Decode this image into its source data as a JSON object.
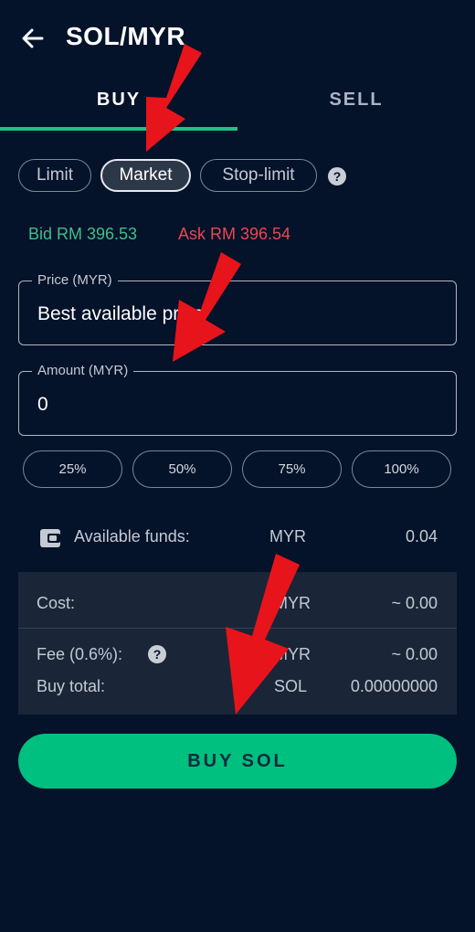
{
  "header": {
    "title": "SOL/MYR"
  },
  "tabs": [
    {
      "label": "BUY"
    },
    {
      "label": "SELL"
    }
  ],
  "order_types": [
    {
      "label": "Limit"
    },
    {
      "label": "Market"
    },
    {
      "label": "Stop-limit"
    }
  ],
  "help_glyph": "?",
  "quotes": {
    "bid": "Bid RM 396.53",
    "ask": "Ask RM 396.54"
  },
  "price_field": {
    "label": "Price (MYR)",
    "value": "Best available price"
  },
  "amount_field": {
    "label": "Amount (MYR)",
    "value": "0"
  },
  "percent_buttons": [
    {
      "label": "25%"
    },
    {
      "label": "50%"
    },
    {
      "label": "75%"
    },
    {
      "label": "100%"
    }
  ],
  "funds": {
    "label": "Available funds:",
    "currency": "MYR",
    "value": "0.04"
  },
  "summary": {
    "cost": {
      "label": "Cost:",
      "currency": "MYR",
      "value": "~ 0.00"
    },
    "fee": {
      "label": "Fee (0.6%):",
      "currency": "MYR",
      "value": "~ 0.00"
    },
    "total": {
      "label": "Buy total:",
      "currency": "SOL",
      "value": "0.00000000"
    }
  },
  "buy_button": {
    "label": "BUY SOL"
  },
  "colors": {
    "accent": "#00c07f",
    "bid": "#3fbf8a",
    "ask": "#e9484f",
    "background": "#04122a",
    "annotation_arrow": "#e8141b"
  }
}
